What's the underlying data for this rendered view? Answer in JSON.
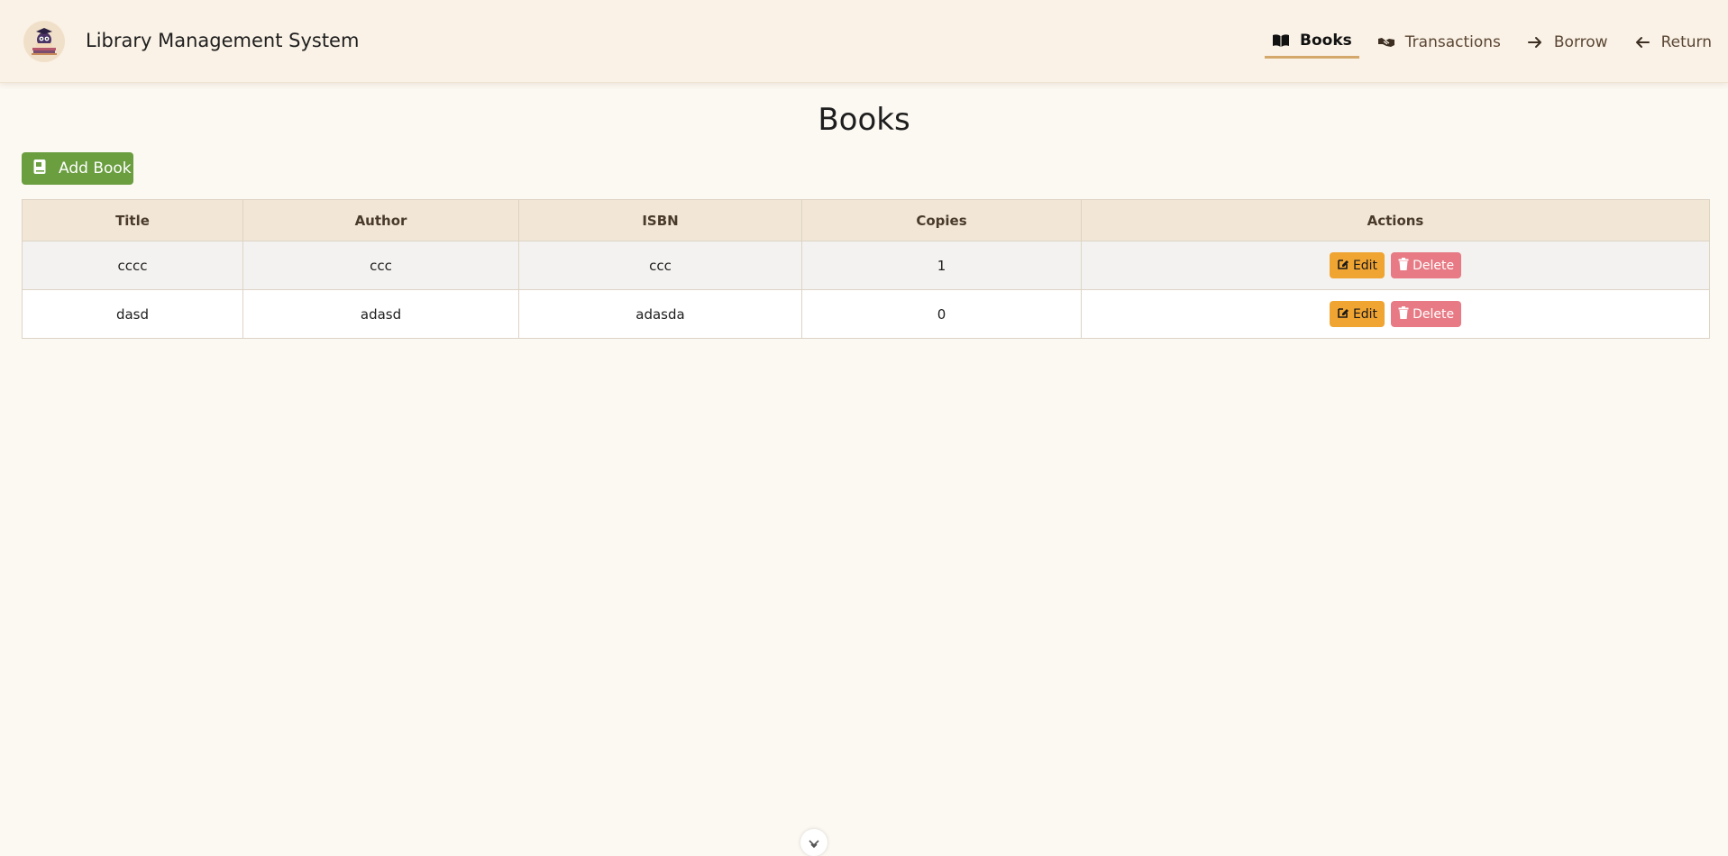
{
  "header": {
    "logo_icon": "library-owl-logo-icon",
    "title": "Library Management System"
  },
  "nav": {
    "items": [
      {
        "label": "Books",
        "icon": "open-book-icon",
        "active": true
      },
      {
        "label": "Transactions",
        "icon": "handshake-icon",
        "active": false
      },
      {
        "label": "Borrow",
        "icon": "arrow-right-icon",
        "active": false
      },
      {
        "label": "Return",
        "icon": "arrow-left-icon",
        "active": false
      }
    ]
  },
  "main": {
    "page_title": "Books",
    "add_button_label": "Add Book",
    "add_button_icon": "book-icon"
  },
  "table": {
    "columns": [
      "Title",
      "Author",
      "ISBN",
      "Copies",
      "Actions"
    ],
    "rows": [
      {
        "title": "cccc",
        "author": "ccc",
        "isbn": "ccc",
        "copies": "1",
        "edit_label": "Edit",
        "delete_label": "Delete"
      },
      {
        "title": "dasd",
        "author": "adasd",
        "isbn": "adasda",
        "copies": "0",
        "edit_label": "Edit",
        "delete_label": "Delete"
      }
    ]
  },
  "colors": {
    "header_bg": "#faf2e6",
    "page_bg": "#fcf8f2",
    "add_button": "#6a9e3f",
    "edit_button": "#f0a431",
    "delete_button": "#e77a84",
    "active_underline": "#d4a86a"
  }
}
